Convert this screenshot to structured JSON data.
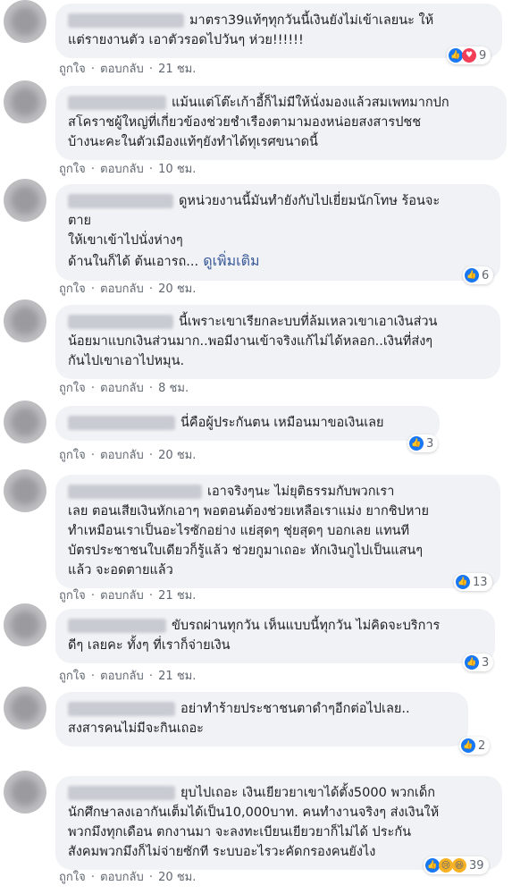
{
  "actions": {
    "like": "ถูกใจ",
    "reply": "ตอบกลับ",
    "dot": "·"
  },
  "comments": [
    {
      "text": "มาตรา39แท้ๆทุกวันนี้เงินยังไม่เข้าเลยนะ ให้\nแต่รายงานตัว เอาตัวรอดไปวันๆ ห่วย!!!!!!",
      "time": "21 ชม.",
      "reactions": "9"
    },
    {
      "text": "แม้นแต่โต๊ะเก้าอี้ก็ไม่มีให้นั่งมองแล้วสมเพทมากปก\nสโคราชผู้ใหญ่ที่เกี่ยวข้องช่วยชำเรืองตามามองหน่อยสงสารปชช\nบ้างนะคะในตัวเมืองแท้ๆยังทำได้ทุเรศขนาดนี้",
      "time": "10 ชม.",
      "reactions": ""
    },
    {
      "text": "ดูหน่วยงานนี้มันทำยังกับไปเยี่ยมนักโทษ ร้อนจะ\nตาย\nให้เขาเข้าไปนั่งห่างๆ\nด้านในก็ได้ ต้นเอารถ...",
      "see_more": "ดูเพิ่มเติม",
      "time": "20 ชม.",
      "reactions": "6"
    },
    {
      "text": "นี้เพราะเขาเรียกละบบที่ล้มเหลวเขาเอาเงินส่วน\nน้อยมาแบกเงินส่วนมาก..พอมีงานเข้าจริงแก้ไม่ได้หลอก..เงินที่ส่งๆ\nกันไปเขาเอาไปหมุน.",
      "time": "8 ชม.",
      "reactions": ""
    },
    {
      "text": "นี่คือผู้ประกันตน เหมือนมาขอเงินเลย",
      "time": "20 ชม.",
      "reactions": "3"
    },
    {
      "text": "เอาจริงๆนะ ไม่ยุติธรรมกับพวกเรา\nเลย ตอนเสียเงินหักเอาๆ พอตอนต้องช่วยเหลือเราแม่ง ยากชิปหาย\nทำเหมือนเราเป็นอะไรซักอย่าง แย่สุดๆ ชุ่ยสุดๆ บอกเลย แทนที\nบัตรประชาชนใบเดียวก็รู้แล้ว ช่วยกูมาเถอะ หักเงินกูไปเป็นแสนๆ\nแล้ว จะอดตายแล้ว",
      "time": "21 ชม.",
      "reactions": "13"
    },
    {
      "text": "ขับรถผ่านทุกวัน เห็นแบบนี้ทุกวัน ไม่คิดจะบริการ\nดีๆ เลยคะ ทั้งๆ ที่เราก็จ่ายเงิน",
      "time": "21 ชม.",
      "reactions": "3"
    },
    {
      "text": "อย่าทำร้ายประชาชนตาดำๆอีกต่อไปเลย..\nสงสารคนไม่มีจะกินเถอะ",
      "time": "",
      "reactions": "2"
    },
    {
      "text": "ยุบไปเถอะ เงินเยียวยาเขาได้ตั้ง5000 พวกเด็ก\nนักศึกษาลงเอากันเต็มได้เป็น10,000บาท. คนทำงานจริงๆ ส่งเงินให้\nพวกมึงทุกเดือน ตกงานมา จะลงทะเบียนเยียวยาก็ไม่ได้ ประกัน\nสังคมพวกมึงก็ไม่จ่ายซักที ระบบอะไรวะคัดกรองคนยังไง",
      "time": "20 ชม.",
      "reactions": "39"
    }
  ]
}
